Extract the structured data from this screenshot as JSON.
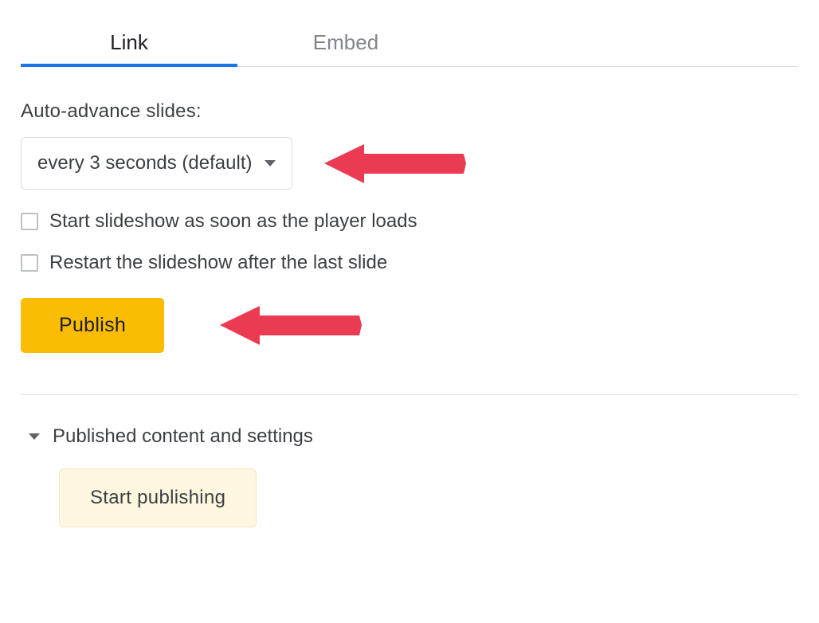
{
  "tabs": {
    "link": "Link",
    "embed": "Embed"
  },
  "autoAdvance": {
    "label": "Auto-advance slides:",
    "selected": "every 3 seconds (default)"
  },
  "checkboxes": {
    "startOnLoad": "Start slideshow as soon as the player loads",
    "restartAfterLast": "Restart the slideshow after the last slide"
  },
  "buttons": {
    "publish": "Publish",
    "startPublishing": "Start publishing"
  },
  "expander": {
    "publishedContent": "Published content and settings"
  },
  "colors": {
    "accent": "#1a73e8",
    "publishBg": "#fbbc04",
    "arrow": "#ea3b52"
  }
}
